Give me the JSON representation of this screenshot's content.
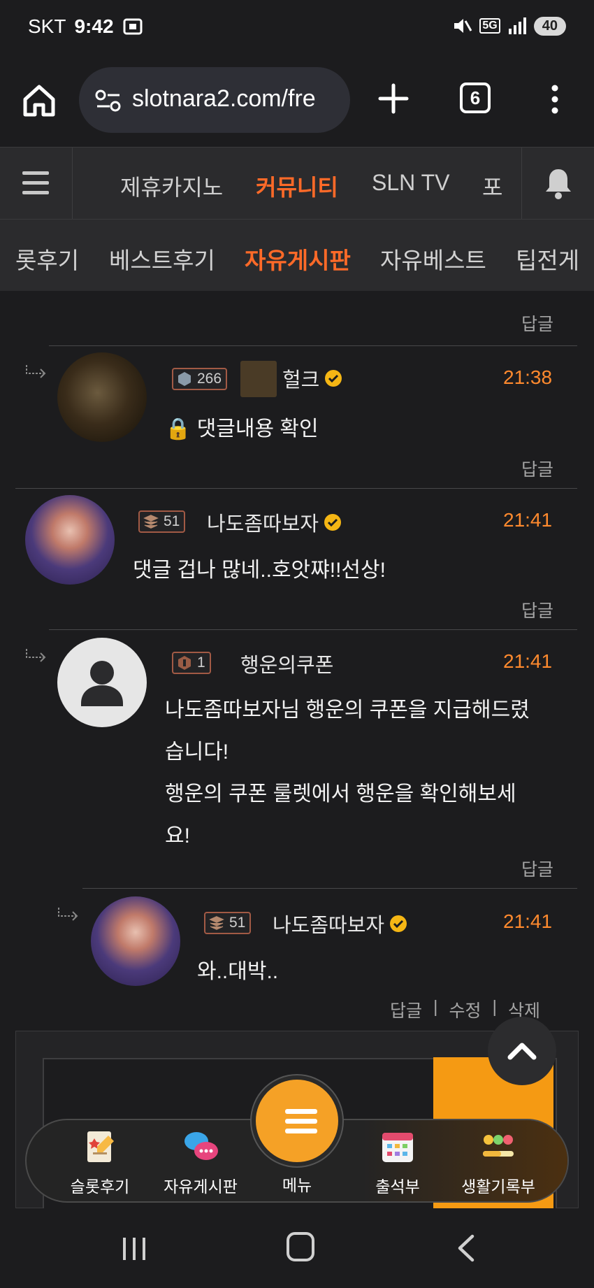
{
  "status": {
    "carrier": "SKT",
    "time": "9:42",
    "network": "5G",
    "battery": "40"
  },
  "browser": {
    "url": "slotnara2.com/fre",
    "tab_count": "6"
  },
  "nav": {
    "items": [
      "제휴카지노",
      "커뮤니티",
      "SLN TV",
      "포"
    ],
    "active": "커뮤니티"
  },
  "subnav": {
    "items": [
      "롯후기",
      "베스트후기",
      "자유게시판",
      "자유베스트",
      "팁전게"
    ],
    "active": "자유게시판"
  },
  "comments": [
    {
      "nick": "헐크",
      "level": "266",
      "time": "21:38",
      "text": "🔒 댓글내용 확인",
      "reply": "답글"
    },
    {
      "nick": "나도좀따보자",
      "level": "51",
      "time": "21:41",
      "text": "댓글 겁나 많네..호앗쨔!!선상!",
      "reply": "답글"
    },
    {
      "nick": "행운의쿠폰",
      "level": "1",
      "time": "21:41",
      "lines": [
        "나도좀따보자님 행운의 쿠폰을 지급해드렸",
        "습니다!",
        "행운의 쿠폰 룰렛에서 행운을 확인해보세",
        "요!"
      ],
      "reply": "답글"
    },
    {
      "nick": "나도좀따보자",
      "level": "51",
      "time": "21:41",
      "text": "와..대박..",
      "reply": "답글",
      "edit": "수정",
      "delete": "삭제"
    }
  ],
  "top_reply": "답글",
  "separator": "|",
  "bottom_nav": {
    "items": [
      "슬롯후기",
      "자유게시판",
      "메뉴",
      "출석부",
      "생활기록부"
    ]
  },
  "colors": {
    "accent": "#ff6a28",
    "time": "#ff8a2e",
    "menu_button": "#f5a126"
  }
}
